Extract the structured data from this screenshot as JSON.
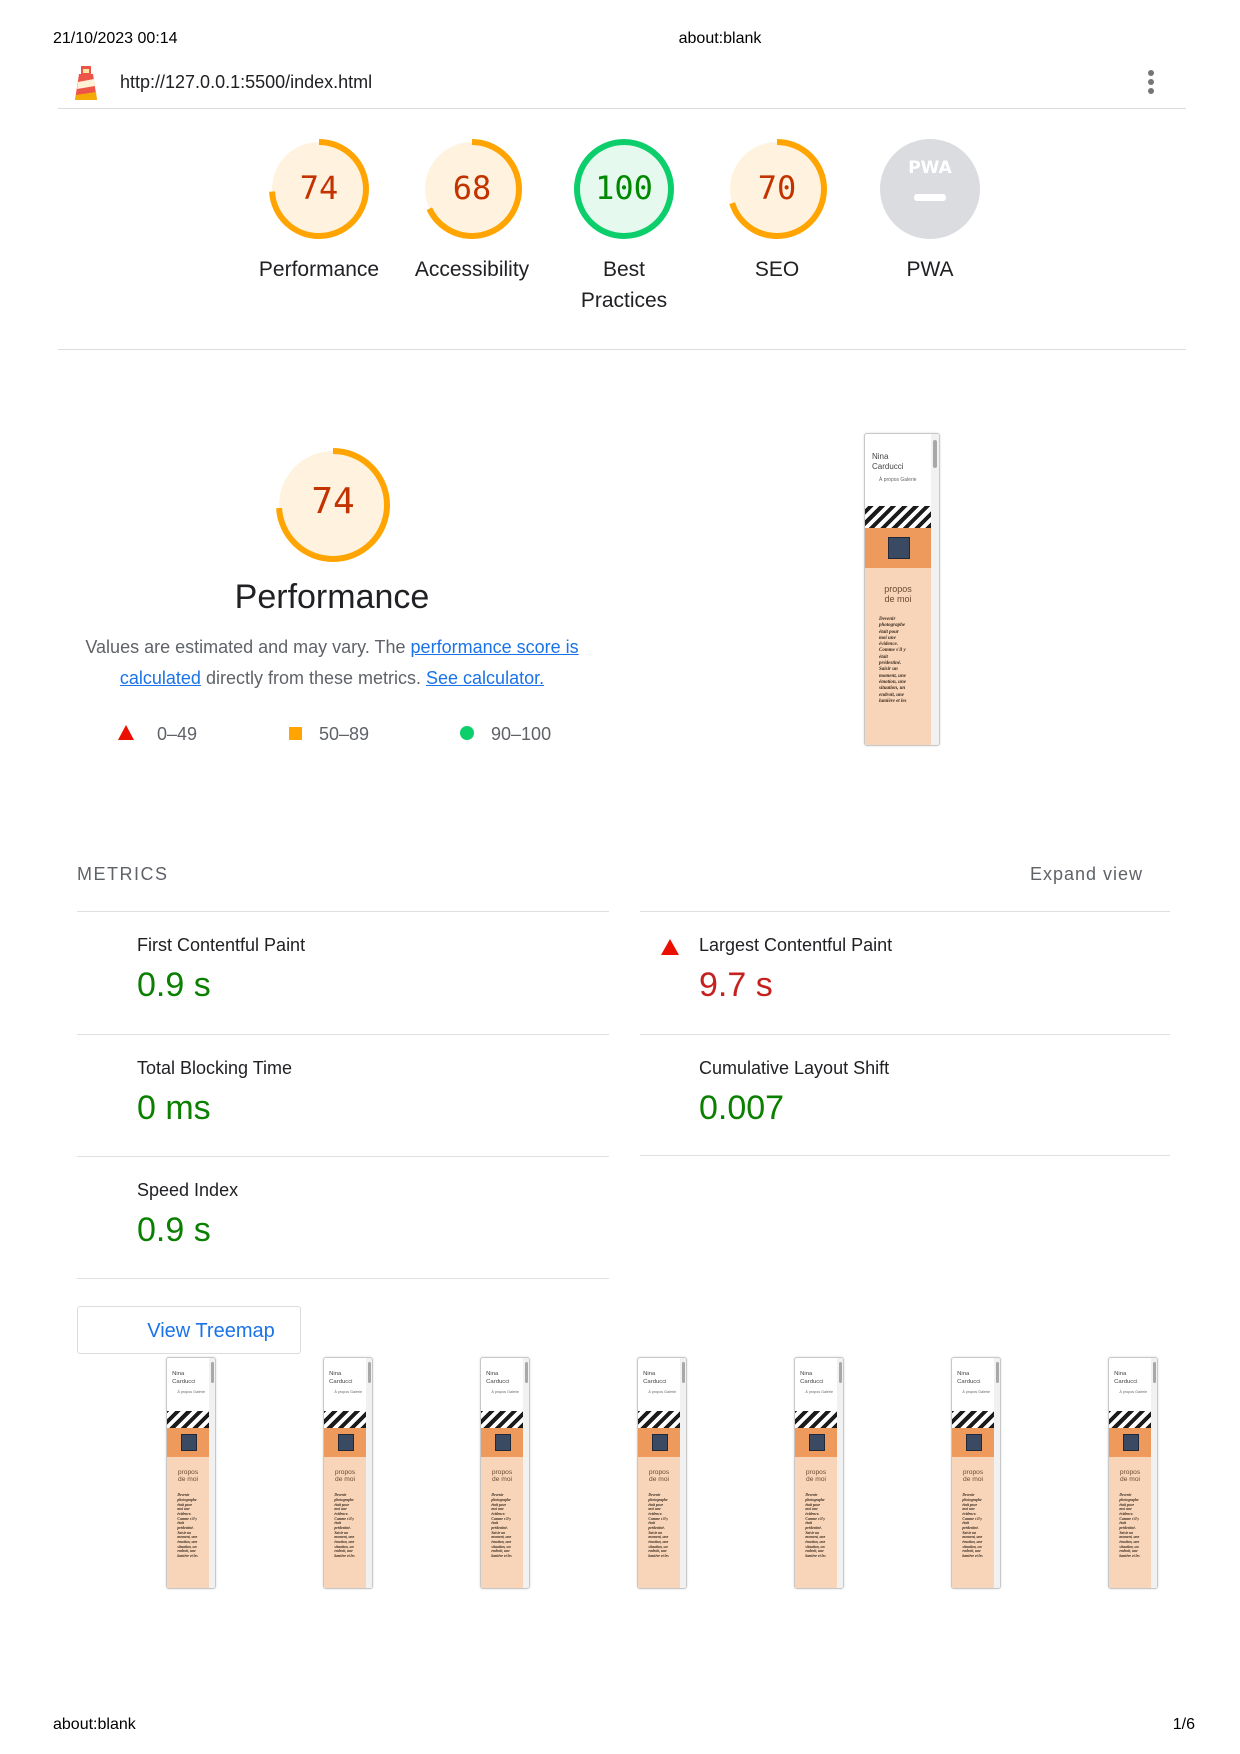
{
  "print_header": {
    "datetime": "21/10/2023 00:14",
    "title": "about:blank"
  },
  "print_footer": {
    "url": "about:blank",
    "page": "1/6"
  },
  "topbar": {
    "url": "http://127.0.0.1:5500/index.html",
    "logo_icon": "lighthouse-icon",
    "menu_icon": "kebab-menu-icon"
  },
  "categories": [
    {
      "id": "performance",
      "label": "Performance",
      "score": "74",
      "fraction": 0.74,
      "color": "#ffa400",
      "fill": "#fff3e0",
      "text": "#c33300"
    },
    {
      "id": "accessibility",
      "label": "Accessibility",
      "score": "68",
      "fraction": 0.68,
      "color": "#ffa400",
      "fill": "#fff3e0",
      "text": "#c33300"
    },
    {
      "id": "best-practices",
      "label": "Best Practices",
      "score": "100",
      "fraction": 1.0,
      "color": "#0cce6b",
      "fill": "#e6f9ef",
      "text": "#008800"
    },
    {
      "id": "seo",
      "label": "SEO",
      "score": "70",
      "fraction": 0.7,
      "color": "#ffa400",
      "fill": "#fff3e0",
      "text": "#c33300"
    },
    {
      "id": "pwa",
      "label": "PWA",
      "badge": "PWA"
    }
  ],
  "performance": {
    "score": "74",
    "fraction": 0.74,
    "title": "Performance",
    "desc_pre": "Values are estimated and may vary. The ",
    "desc_link1": "performance score is calculated",
    "desc_mid": " directly from these metrics. ",
    "desc_link2": "See calculator.",
    "legend": [
      {
        "range": "0–49",
        "icon": "red-triangle-icon"
      },
      {
        "range": "50–89",
        "icon": "orange-square-icon"
      },
      {
        "range": "90–100",
        "icon": "green-circle-icon"
      }
    ]
  },
  "screenshot": {
    "name_line1": "Nina",
    "name_line2": "Carducci",
    "nav": "À propos  Galerie",
    "about_line1": "propos",
    "about_line2": "de moi",
    "text_lines": [
      "Devenir",
      "photographe",
      "était pour",
      "moi une",
      "évidence.",
      "Comme s'il y",
      "était",
      "prédestiné.",
      "Saisir un",
      "moment, une",
      "émotion, une",
      "situation, un",
      "endroit, une",
      "lumière et les"
    ]
  },
  "metrics": {
    "heading": "METRICS",
    "expand_label": "Expand view",
    "items": [
      {
        "title": "First Contentful Paint",
        "value": "0.9 s",
        "status": "good"
      },
      {
        "title": "Largest Contentful Paint",
        "value": "9.7 s",
        "status": "bad"
      },
      {
        "title": "Total Blocking Time",
        "value": "0 ms",
        "status": "good"
      },
      {
        "title": "Cumulative Layout Shift",
        "value": "0.007",
        "status": "good"
      },
      {
        "title": "Speed Index",
        "value": "0.9 s",
        "status": "good"
      }
    ]
  },
  "treemap_button": "View Treemap",
  "filmstrip_count": 7
}
